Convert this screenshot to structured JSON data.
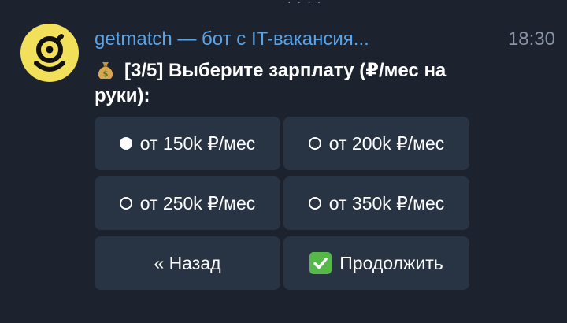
{
  "chat": {
    "sender": "getmatch — бот с IT-вакансия...",
    "time": "18:30",
    "message_text": "[3/5] Выберите зарплату (₽/мес на руки):",
    "message_icon": "money-bag-icon"
  },
  "colors": {
    "background": "#1c232f",
    "button": "#283344",
    "sender": "#5aa3e6",
    "time": "#8a94a4",
    "avatar": "#f3e05a",
    "check": "#57b84a"
  },
  "keyboard": {
    "options": [
      {
        "label": "от 150k ₽/мес",
        "selected": true
      },
      {
        "label": "от 200k ₽/мес",
        "selected": false
      },
      {
        "label": "от 250k ₽/мес",
        "selected": false
      },
      {
        "label": "от 350k ₽/мес",
        "selected": false
      }
    ],
    "back_label": "« Назад",
    "continue_label": "Продолжить"
  }
}
